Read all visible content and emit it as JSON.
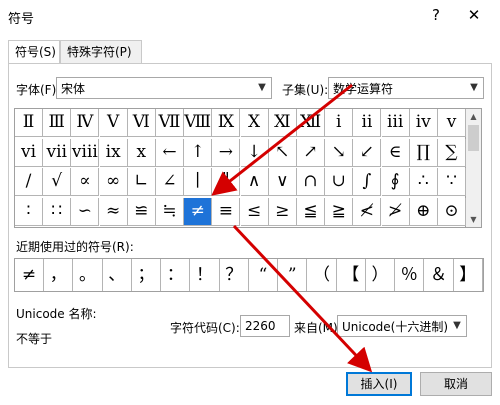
{
  "window": {
    "title": "符号",
    "help": "?",
    "close": "✕"
  },
  "tabs": [
    {
      "label": "符号(S)"
    },
    {
      "label": "特殊字符(P)"
    }
  ],
  "font": {
    "label": "字体(F):",
    "value": "宋体"
  },
  "subset": {
    "label": "子集(U):",
    "value": "数学运算符"
  },
  "grid": {
    "rows": [
      [
        "Ⅱ",
        "Ⅲ",
        "Ⅳ",
        "Ⅴ",
        "Ⅵ",
        "Ⅶ",
        "Ⅷ",
        "Ⅸ",
        "Ⅹ",
        "Ⅺ",
        "Ⅻ",
        "ⅰ",
        "ⅱ",
        "ⅲ",
        "ⅳ",
        "ⅴ"
      ],
      [
        "ⅵ",
        "ⅶ",
        "ⅷ",
        "ⅸ",
        "ⅹ",
        "←",
        "↑",
        "→",
        "↓",
        "↖",
        "↗",
        "↘",
        "↙",
        "∈",
        "∏",
        "∑"
      ],
      [
        "∕",
        "√",
        "∝",
        "∞",
        "∟",
        "∠",
        "∣",
        "∥",
        "∧",
        "∨",
        "∩",
        "∪",
        "∫",
        "∮",
        "∴",
        "∵"
      ],
      [
        "∶",
        "∷",
        "∽",
        "≈",
        "≌",
        "≒",
        "≠",
        "≡",
        "≤",
        "≥",
        "≦",
        "≧",
        "≮",
        "≯",
        "⊕",
        "⊙"
      ]
    ],
    "selected": "≠"
  },
  "recent": {
    "label": "近期使用过的符号(R):",
    "symbols": [
      "≠",
      "，",
      "。",
      "、",
      "；",
      "：",
      "！",
      "？",
      "“",
      "”",
      "（",
      "【",
      "）",
      "％",
      "＆",
      "】"
    ]
  },
  "unicode_name": {
    "label": "Unicode 名称:",
    "value": "不等于"
  },
  "char_code": {
    "label": "字符代码(C):",
    "value": "2260"
  },
  "from": {
    "label": "来自(M):",
    "value": "Unicode(十六进制)"
  },
  "buttons": {
    "insert": "插入(I)",
    "cancel": "取消"
  },
  "colors": {
    "selection": "#1e73d8",
    "arrow": "#d40000",
    "default_border": "#0078d7"
  }
}
